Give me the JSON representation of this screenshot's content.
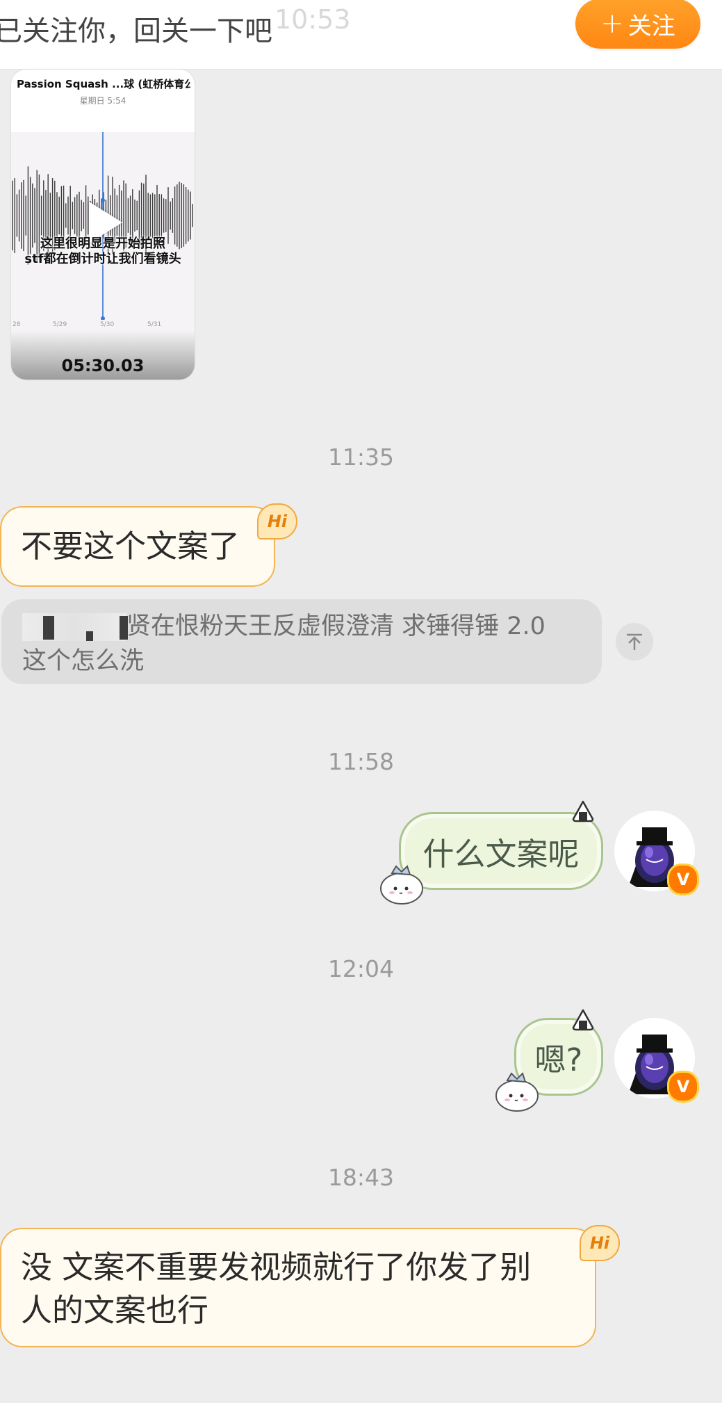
{
  "topbar": {
    "notice": "已关注你，回关一下吧",
    "ghost_time": "10:53",
    "follow_label": "关注"
  },
  "video": {
    "title": "Passion Squash ...球 (虹桥体育公园店)",
    "subtitle": "星期日 5:54",
    "caption_line1": "这里很明显是开始拍照",
    "caption_line2": "stf都在倒计时让我们看镜头",
    "ticks": [
      "28",
      "5/29",
      "5/30",
      "5/31"
    ],
    "duration": "05:30.03"
  },
  "messages": [
    {
      "time": "11:35"
    },
    {
      "incoming": "不要这个文案了",
      "badge": "Hi"
    },
    {
      "quote_line1": "贤在恨粉天王反虚假澄清 求锤得锤 2.0",
      "quote_line2": "这个怎么洗"
    },
    {
      "time": "11:58"
    },
    {
      "outgoing": "什么文案呢"
    },
    {
      "time": "12:04"
    },
    {
      "outgoing": "嗯?"
    },
    {
      "time": "18:43"
    },
    {
      "incoming_line1": "没 文案不重要发视频就行了你发了别",
      "incoming_line2": "人的文案也行",
      "badge": "Hi"
    }
  ],
  "avatar_badge": "V",
  "colors": {
    "follow": "#ff8d19",
    "incoming_border": "#f3b453",
    "outgoing_border": "#a9c58e",
    "background": "#ededed"
  }
}
